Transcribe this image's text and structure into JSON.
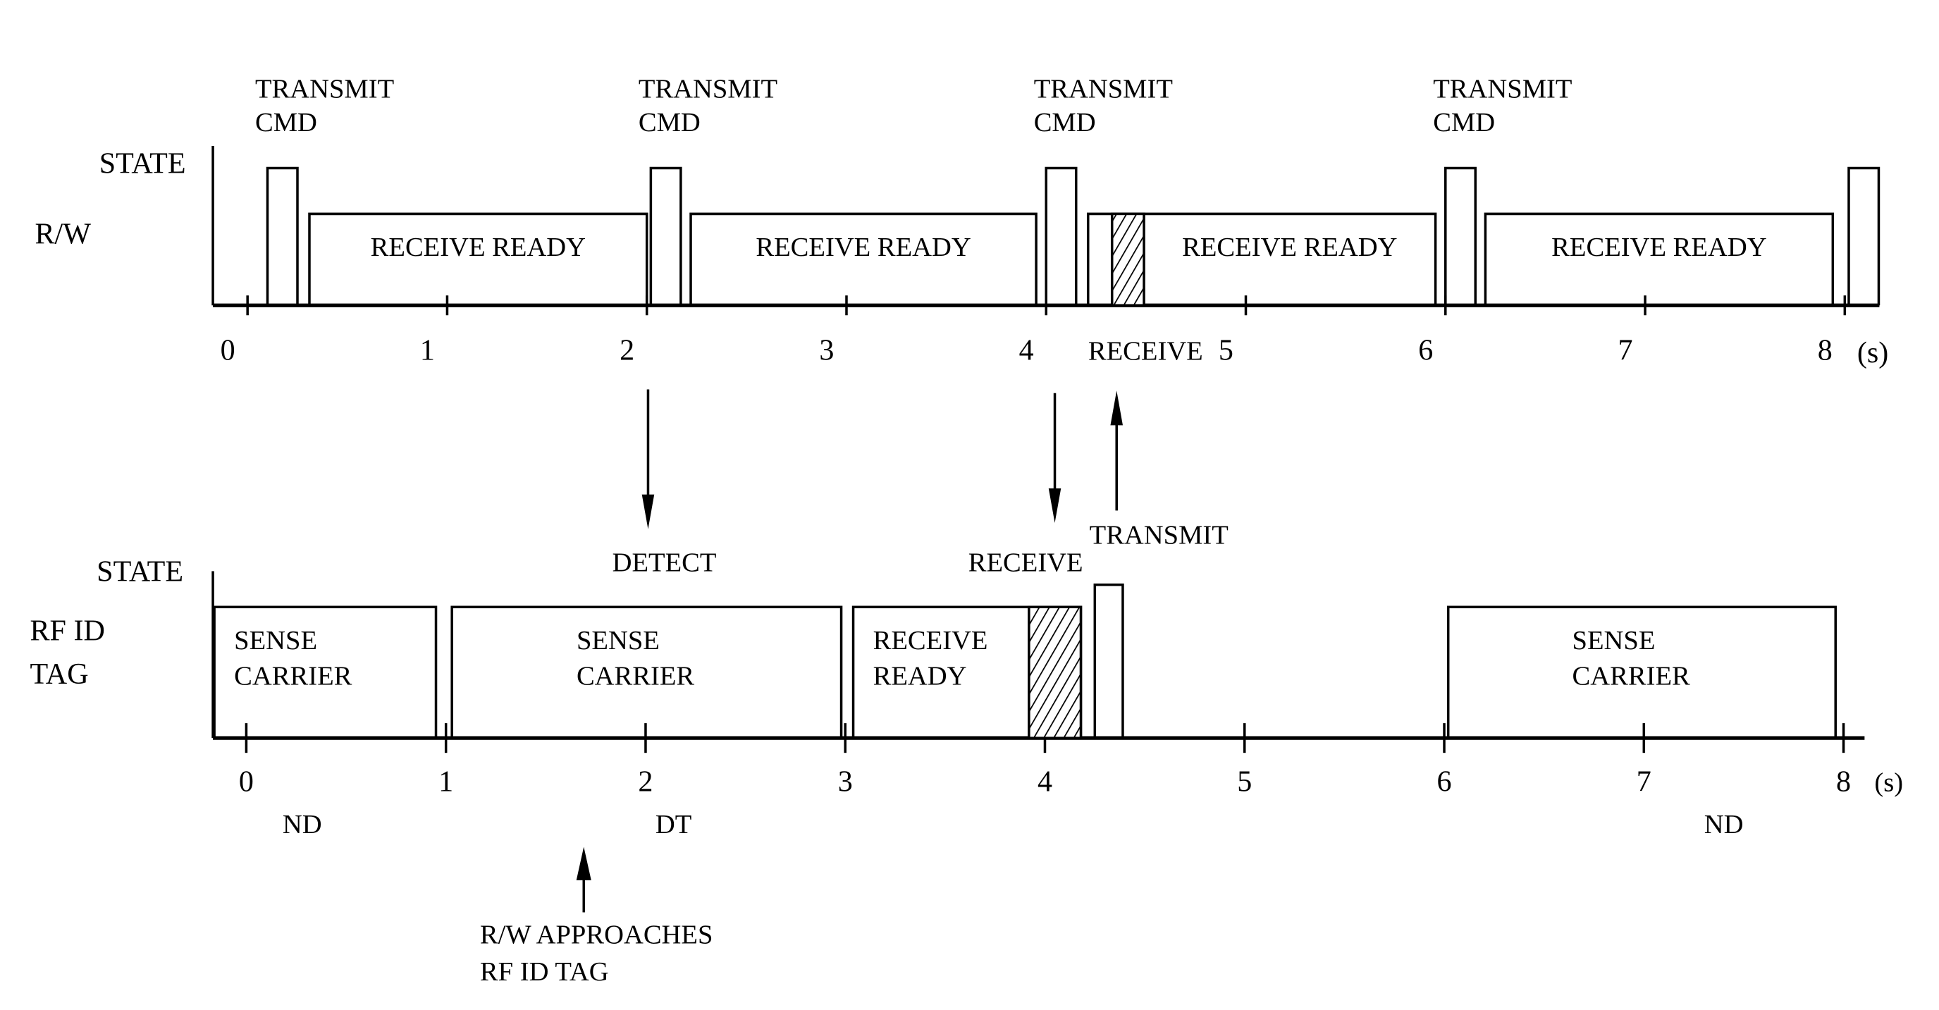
{
  "diagram": {
    "unit_label": "(s)",
    "rw": {
      "row_label": "R/W",
      "axis_label": "STATE",
      "ticks": [
        "0",
        "1",
        "2",
        "3",
        "4",
        "5",
        "6",
        "7",
        "8"
      ],
      "transmit_pulses": [
        {
          "start": 0.1,
          "end": 0.25,
          "label_line1": "TRANSMIT",
          "label_line2": "CMD"
        },
        {
          "start": 2.02,
          "end": 2.17,
          "label_line1": "TRANSMIT",
          "label_line2": "CMD"
        },
        {
          "start": 4.0,
          "end": 4.15,
          "label_line1": "TRANSMIT",
          "label_line2": "CMD"
        },
        {
          "start": 6.0,
          "end": 6.15,
          "label_line1": "TRANSMIT",
          "label_line2": "CMD"
        },
        {
          "start": 8.02,
          "end": 8.17,
          "label_line1": "",
          "label_line2": ""
        }
      ],
      "receive_ready": [
        {
          "start": 0.31,
          "end": 2.0,
          "label": "RECEIVE READY"
        },
        {
          "start": 2.22,
          "end": 3.95,
          "label": "RECEIVE READY"
        },
        {
          "start": 4.21,
          "end": 5.95,
          "label": "RECEIVE READY",
          "hatched": {
            "start": 4.33,
            "end": 4.49
          }
        },
        {
          "start": 6.2,
          "end": 7.94,
          "label": "RECEIVE READY"
        }
      ],
      "receive_marker_label": "RECEIVE"
    },
    "tag": {
      "row_label_line1": "RF ID",
      "row_label_line2": "TAG",
      "axis_label": "STATE",
      "ticks": [
        "0",
        "1",
        "2",
        "3",
        "4",
        "5",
        "6",
        "7",
        "8"
      ],
      "states": [
        {
          "start": -0.16,
          "end": 0.95,
          "label_line1": "SENSE",
          "label_line2": "CARRIER"
        },
        {
          "start": 1.03,
          "end": 2.98,
          "label_line1": "SENSE",
          "label_line2": "CARRIER"
        },
        {
          "start": 3.04,
          "end": 4.18,
          "label_line1": "RECEIVE",
          "label_line2": "READY",
          "hatched": {
            "start": 3.92,
            "end": 4.18
          }
        },
        {
          "start": 6.02,
          "end": 7.96,
          "label_line1": "SENSE",
          "label_line2": "CARRIER"
        }
      ],
      "transmit_pulse": {
        "start": 4.25,
        "end": 4.39
      },
      "mode_labels": [
        {
          "at": 0.28,
          "text": "ND"
        },
        {
          "at": 2.14,
          "text": "DT"
        },
        {
          "at": 7.4,
          "text": "ND"
        }
      ]
    },
    "arrows": {
      "detect": {
        "label": "DETECT",
        "direction": "down"
      },
      "receive": {
        "label": "RECEIVE",
        "direction": "down"
      },
      "transmit": {
        "label": "TRANSMIT",
        "direction": "up"
      },
      "approach": {
        "line1": "R/W APPROACHES",
        "line2": "RF ID TAG",
        "direction": "up"
      }
    }
  }
}
